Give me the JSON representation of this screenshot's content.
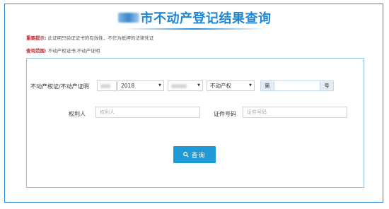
{
  "page": {
    "title": "市不动产登记结果查询",
    "important_label": "重要提示:",
    "important_text": "此证明只验证证书的有效性，不作为抵押的法律凭证",
    "scope_label": "查询范围:",
    "scope_text": "不动产权证书,不动产证明"
  },
  "form": {
    "cert_label": "不动产权证/不动产证明",
    "year_value": "2018",
    "cert_type_value": "不动产权",
    "prefix_label": "第",
    "number_value": "",
    "suffix_label": "号",
    "owner_label": "权利人",
    "owner_placeholder": "权利人",
    "idno_label": "证件号码",
    "idno_placeholder": "证件号码",
    "search_label": "查询"
  },
  "colors": {
    "accent": "#1f9ad6",
    "title": "#1f86d6",
    "warning": "#c0272d",
    "border": "#2f8bd3"
  },
  "icons": [
    "search-icon",
    "chevron-down-icon"
  ]
}
